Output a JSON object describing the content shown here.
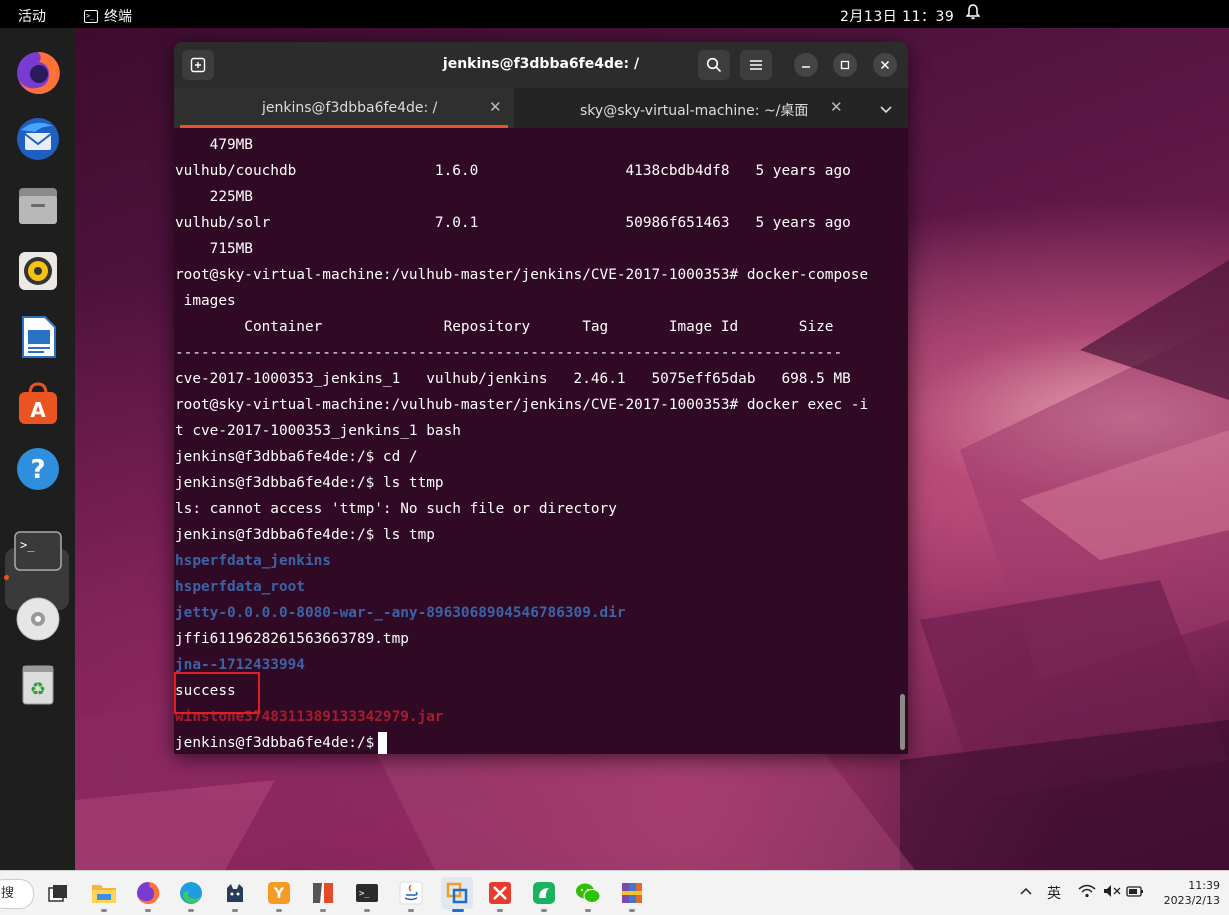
{
  "topbar": {
    "activities": "活动",
    "app_name": "终端",
    "clock": "2月13日  11：39"
  },
  "dock": {
    "apps": [
      "firefox-icon",
      "thunderbird-icon",
      "files-icon",
      "rhythmbox-icon",
      "libreoffice-writer-icon",
      "app-center-icon",
      "help-icon",
      "terminal-icon",
      "disc-icon",
      "trash-icon"
    ],
    "active": "terminal-icon"
  },
  "terminal": {
    "title": "jenkins@f3dbba6fe4de: /",
    "tabs": [
      {
        "label": "jenkins@f3dbba6fe4de: /",
        "active": true
      },
      {
        "label": "sky@sky-virtual-machine: ~/桌面",
        "active": false
      }
    ],
    "lines": [
      {
        "text": "    479MB",
        "style": "normal"
      },
      {
        "text": "vulhub/couchdb                1.6.0                 4138cbdb4df8   5 years ago",
        "style": "normal"
      },
      {
        "text": "    225MB",
        "style": "normal"
      },
      {
        "text": "vulhub/solr                   7.0.1                 50986f651463   5 years ago",
        "style": "normal"
      },
      {
        "text": "    715MB",
        "style": "normal"
      },
      {
        "text": "root@sky-virtual-machine:/vulhub-master/jenkins/CVE-2017-1000353# docker-compose",
        "style": "normal"
      },
      {
        "text": " images",
        "style": "normal"
      },
      {
        "text": "        Container              Repository      Tag       Image Id       Size",
        "style": "normal"
      },
      {
        "text": "-----------------------------------------------------------------------------",
        "style": "normal"
      },
      {
        "text": "cve-2017-1000353_jenkins_1   vulhub/jenkins   2.46.1   5075eff65dab   698.5 MB",
        "style": "normal"
      },
      {
        "text": "root@sky-virtual-machine:/vulhub-master/jenkins/CVE-2017-1000353# docker exec -i",
        "style": "normal"
      },
      {
        "text": "t cve-2017-1000353_jenkins_1 bash",
        "style": "normal"
      },
      {
        "text": "jenkins@f3dbba6fe4de:/$ cd /",
        "style": "normal"
      },
      {
        "text": "jenkins@f3dbba6fe4de:/$ ls ttmp",
        "style": "normal"
      },
      {
        "text": "ls: cannot access 'ttmp': No such file or directory",
        "style": "normal"
      },
      {
        "text": "jenkins@f3dbba6fe4de:/$ ls tmp",
        "style": "normal"
      },
      {
        "text": "hsperfdata_jenkins",
        "style": "blue"
      },
      {
        "text": "hsperfdata_root",
        "style": "blue"
      },
      {
        "text": "jetty-0.0.0.0-8080-war-_-any-8963068904546786309.dir",
        "style": "blue"
      },
      {
        "text": "jffi6119628261563663789.tmp",
        "style": "normal"
      },
      {
        "text": "jna--1712433994",
        "style": "blue"
      },
      {
        "text": "success",
        "style": "normal"
      },
      {
        "text": "winstone3748311389133342979.jar",
        "style": "red"
      },
      {
        "text": "jenkins@f3dbba6fe4de:/$",
        "style": "prompt"
      }
    ]
  },
  "taskbar": {
    "search_label": "搜",
    "apps": [
      "task-view-icon",
      "file-explorer-icon",
      "firefox-icon",
      "edge-icon",
      "cat-app-icon",
      "yuque-icon",
      "split-app-icon",
      "terminal-icon",
      "java-icon",
      "vmware-icon",
      "xmind-icon",
      "green-app-icon",
      "wechat-icon",
      "winrar-icon"
    ],
    "tray_lang": "英",
    "time": "11:39",
    "date": "2023/2/13"
  }
}
